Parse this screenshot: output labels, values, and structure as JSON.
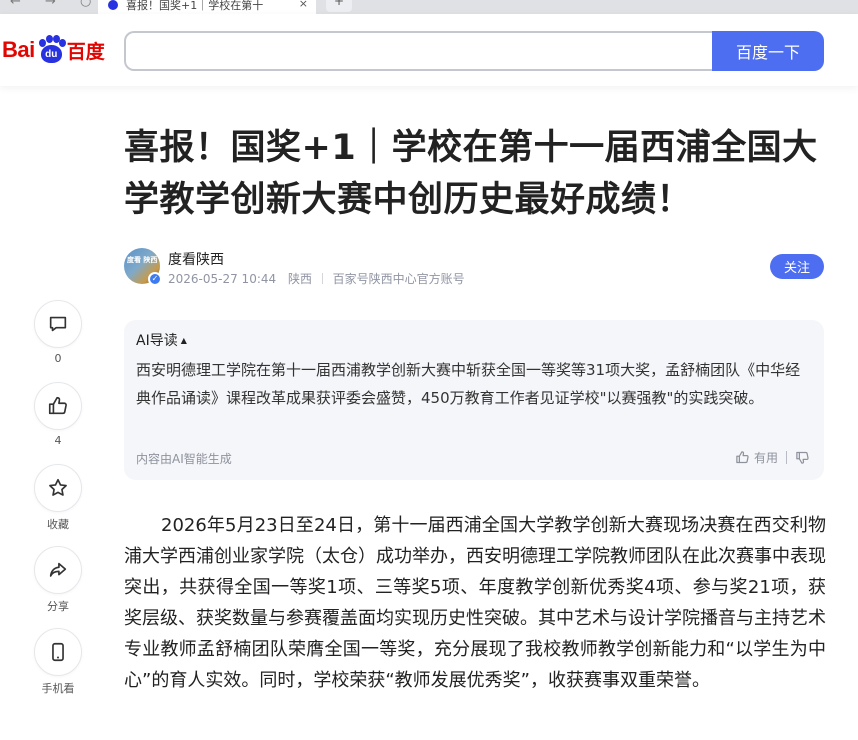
{
  "browser": {
    "nav_glyphs": "← → ○",
    "tab_title": "喜报！国奖+1｜学校在第十",
    "tab_close": "×",
    "new_tab": "+"
  },
  "header": {
    "logo_text_left": "Bai",
    "logo_paw_text": "du",
    "logo_text_right": "百度",
    "search_value": "",
    "search_placeholder": "",
    "search_button": "百度一下"
  },
  "article": {
    "title": "喜报！国奖+1｜学校在第十一届西浦全国大学教学创新大赛中创历史最好成绩！",
    "author": {
      "avatar_text": "度看 陕西",
      "name": "度看陕西",
      "datetime": "2026-05-27 10:44",
      "location": "陕西",
      "account_desc": "百家号陕西中心官方账号",
      "verified_mark": "✓",
      "follow_label": "关注"
    },
    "ai_summary": {
      "heading": "AI导读",
      "caret": "▲",
      "text": "西安明德理工学院在第十一届西浦教学创新大赛中斩获全国一等奖等31项大奖，孟舒楠团队《中华经典作品诵读》课程改革成果获评委会盛赞，450万教育工作者见证学校\"以赛强教\"的实践突破。",
      "footer": "内容由AI智能生成",
      "useful_label": "有用"
    },
    "body": "2026年5月23日至24日，第十一届西浦全国大学教学创新大赛现场决赛在西交利物浦大学西浦创业家学院（太仓）成功举办，西安明德理工学院教师团队在此次赛事中表现突出，共获得全国一等奖1项、三等奖5项、年度教学创新优秀奖4项、参与奖21项，获奖层级、获奖数量与参赛覆盖面均实现历史性突破。其中艺术与设计学院播音与主持艺术专业教师孟舒楠团队荣膺全国一等奖，充分展现了我校教师教学创新能力和“以学生为中心”的育人实效。同时，学校荣获“教师发展优秀奖”，收获赛事双重荣誉。"
  },
  "side_rail": [
    {
      "icon": "comment-icon",
      "label": "0"
    },
    {
      "icon": "thumbs-up-icon",
      "label": "4"
    },
    {
      "icon": "star-icon",
      "label": "收藏"
    },
    {
      "icon": "share-icon",
      "label": "分享"
    },
    {
      "icon": "phone-icon",
      "label": "手机看"
    }
  ],
  "colors": {
    "brand_blue": "#4e6ef2",
    "logo_red": "#e10602",
    "logo_blue": "#2932e1",
    "card_bg": "#f5f6f9",
    "meta_gray": "#9195a3"
  }
}
